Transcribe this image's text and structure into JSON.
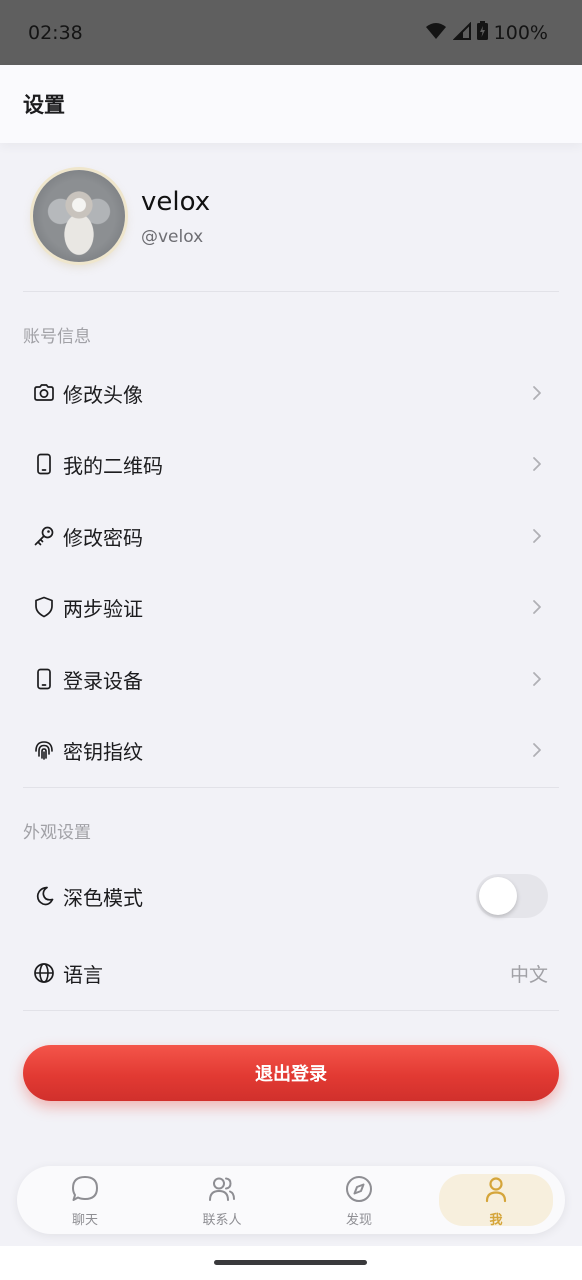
{
  "status_bar": {
    "time": "02:38",
    "battery": "100%"
  },
  "header": {
    "title": "设置"
  },
  "profile": {
    "name": "velox",
    "handle": "@velox"
  },
  "account_section": {
    "title": "账号信息",
    "items": [
      {
        "label": "修改头像",
        "icon": "camera-icon"
      },
      {
        "label": "我的二维码",
        "icon": "phone-icon"
      },
      {
        "label": "修改密码",
        "icon": "key-icon"
      },
      {
        "label": "两步验证",
        "icon": "shield-icon"
      },
      {
        "label": "登录设备",
        "icon": "phone-icon"
      },
      {
        "label": "密钥指纹",
        "icon": "fingerprint-icon"
      }
    ]
  },
  "appearance_section": {
    "title": "外观设置",
    "dark_mode": {
      "label": "深色模式",
      "enabled": false
    },
    "language": {
      "label": "语言",
      "value": "中文"
    }
  },
  "logout": {
    "label": "退出登录",
    "color": "#e53935"
  },
  "tabbar": {
    "active_color": "#d5a53a",
    "tabs": [
      {
        "label": "聊天",
        "icon": "chat-icon"
      },
      {
        "label": "联系人",
        "icon": "contacts-icon"
      },
      {
        "label": "发现",
        "icon": "compass-icon"
      },
      {
        "label": "我",
        "icon": "person-icon",
        "active": true
      }
    ]
  }
}
